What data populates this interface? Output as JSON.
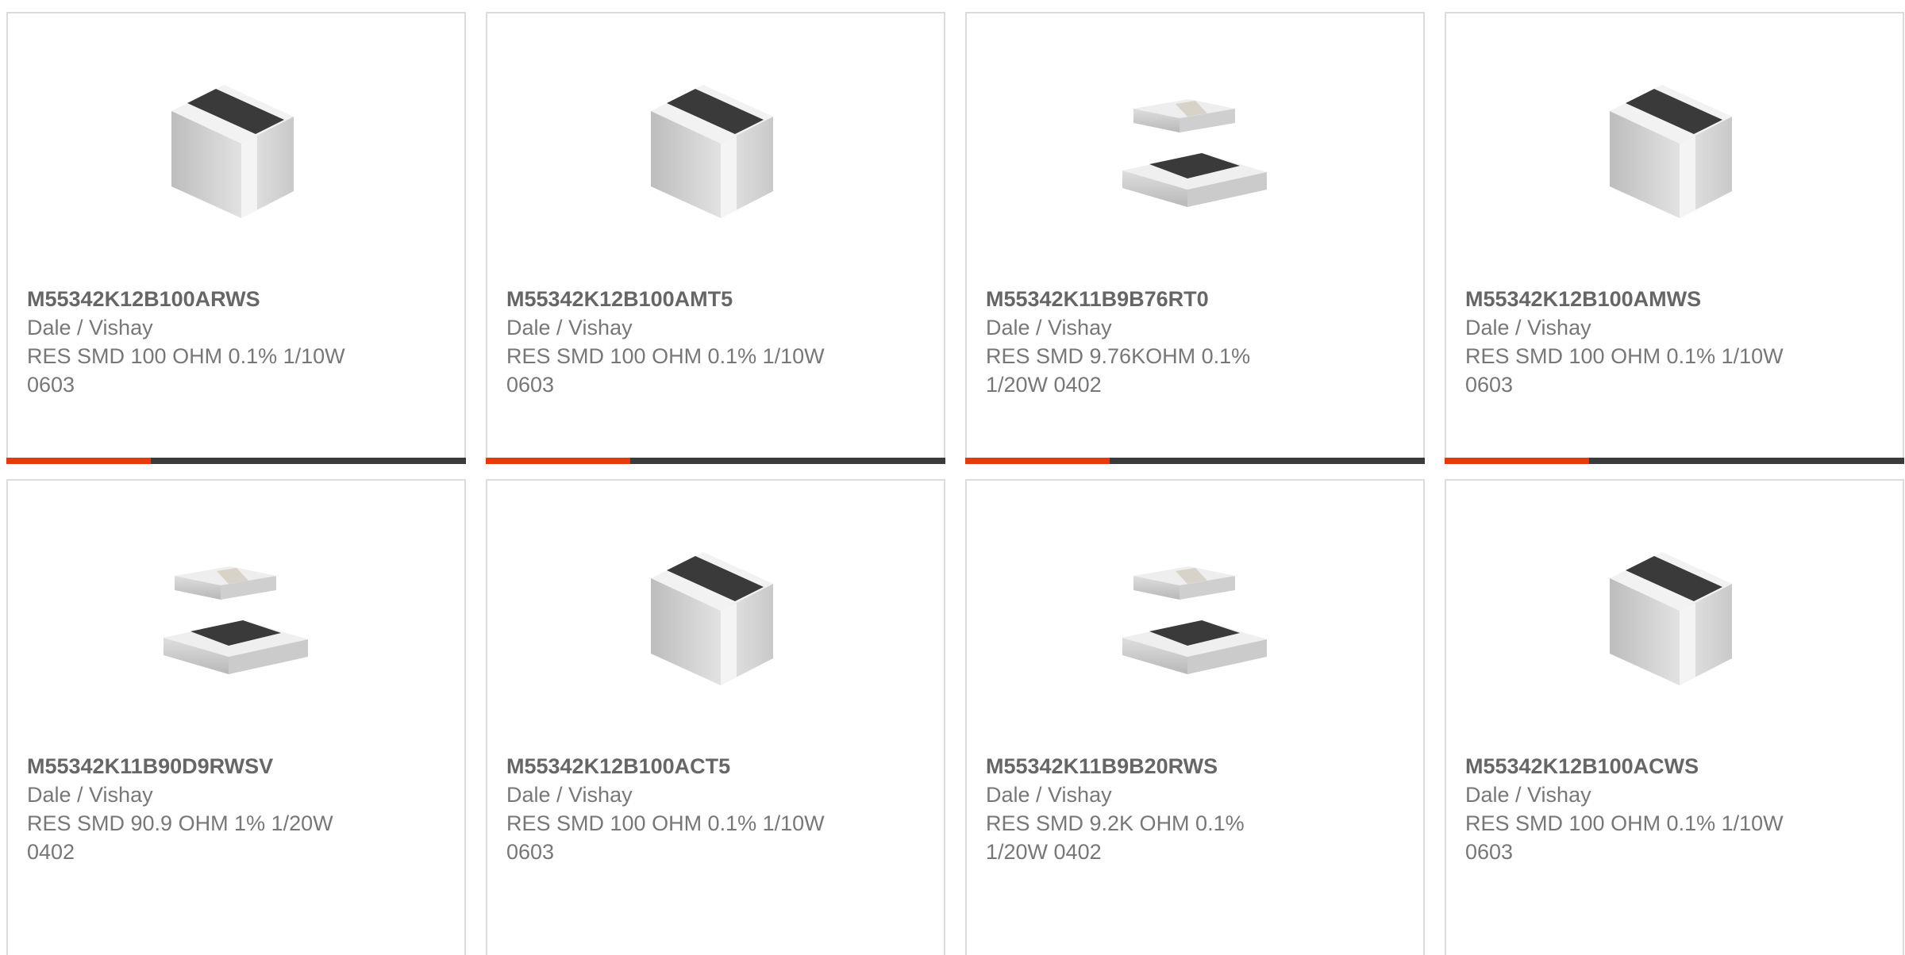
{
  "colors": {
    "accent": "#e8380d",
    "bar_dark": "#3b3b3b",
    "border": "#dcdcdc",
    "text": "#6b6b6b"
  },
  "products": [
    {
      "part_number": "M55342K12B100ARWS",
      "manufacturer": "Dale / Vishay",
      "description": "RES SMD 100 OHM 0.1% 1/10W\n0603",
      "image": "chip-resistor-0603-icon"
    },
    {
      "part_number": "M55342K12B100AMT5",
      "manufacturer": "Dale / Vishay",
      "description": "RES SMD 100 OHM 0.1% 1/10W\n0603",
      "image": "chip-resistor-0603-icon"
    },
    {
      "part_number": "M55342K11B9B76RT0",
      "manufacturer": "Dale / Vishay",
      "description": "RES SMD 9.76KOHM 0.1%\n1/20W 0402",
      "image": "chip-resistor-0402-icon"
    },
    {
      "part_number": "M55342K12B100AMWS",
      "manufacturer": "Dale / Vishay",
      "description": "RES SMD 100 OHM 0.1% 1/10W\n0603",
      "image": "chip-resistor-0603-icon"
    },
    {
      "part_number": "M55342K11B90D9RWSV",
      "manufacturer": "Dale / Vishay",
      "description": "RES SMD 90.9 OHM 1% 1/20W\n0402",
      "image": "chip-resistor-0402-icon"
    },
    {
      "part_number": "M55342K12B100ACT5",
      "manufacturer": "Dale / Vishay",
      "description": "RES SMD 100 OHM 0.1% 1/10W\n0603",
      "image": "chip-resistor-0603-icon"
    },
    {
      "part_number": "M55342K11B9B20RWS",
      "manufacturer": "Dale / Vishay",
      "description": "RES SMD 9.2K OHM 0.1%\n1/20W 0402",
      "image": "chip-resistor-0402-icon"
    },
    {
      "part_number": "M55342K12B100ACWS",
      "manufacturer": "Dale / Vishay",
      "description": "RES SMD 100 OHM 0.1% 1/10W\n0603",
      "image": "chip-resistor-0603-icon"
    }
  ]
}
